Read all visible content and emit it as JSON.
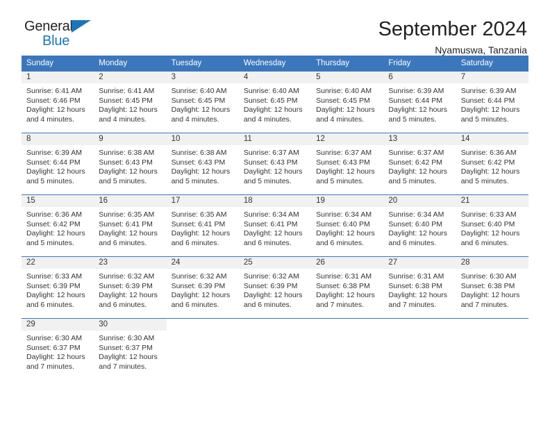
{
  "brand": {
    "name_part1": "General",
    "name_part2": "Blue",
    "accent_color": "#1b75bb"
  },
  "header": {
    "title": "September 2024",
    "location": "Nyamuswa, Tanzania"
  },
  "calendar": {
    "header_bg": "#3b77bc",
    "daynum_bg": "#f1f1f1",
    "weekday_headers": [
      "Sunday",
      "Monday",
      "Tuesday",
      "Wednesday",
      "Thursday",
      "Friday",
      "Saturday"
    ],
    "weeks": [
      [
        {
          "day": "1",
          "sunrise": "Sunrise: 6:41 AM",
          "sunset": "Sunset: 6:46 PM",
          "daylight": "Daylight: 12 hours and 4 minutes."
        },
        {
          "day": "2",
          "sunrise": "Sunrise: 6:41 AM",
          "sunset": "Sunset: 6:45 PM",
          "daylight": "Daylight: 12 hours and 4 minutes."
        },
        {
          "day": "3",
          "sunrise": "Sunrise: 6:40 AM",
          "sunset": "Sunset: 6:45 PM",
          "daylight": "Daylight: 12 hours and 4 minutes."
        },
        {
          "day": "4",
          "sunrise": "Sunrise: 6:40 AM",
          "sunset": "Sunset: 6:45 PM",
          "daylight": "Daylight: 12 hours and 4 minutes."
        },
        {
          "day": "5",
          "sunrise": "Sunrise: 6:40 AM",
          "sunset": "Sunset: 6:45 PM",
          "daylight": "Daylight: 12 hours and 4 minutes."
        },
        {
          "day": "6",
          "sunrise": "Sunrise: 6:39 AM",
          "sunset": "Sunset: 6:44 PM",
          "daylight": "Daylight: 12 hours and 5 minutes."
        },
        {
          "day": "7",
          "sunrise": "Sunrise: 6:39 AM",
          "sunset": "Sunset: 6:44 PM",
          "daylight": "Daylight: 12 hours and 5 minutes."
        }
      ],
      [
        {
          "day": "8",
          "sunrise": "Sunrise: 6:39 AM",
          "sunset": "Sunset: 6:44 PM",
          "daylight": "Daylight: 12 hours and 5 minutes."
        },
        {
          "day": "9",
          "sunrise": "Sunrise: 6:38 AM",
          "sunset": "Sunset: 6:43 PM",
          "daylight": "Daylight: 12 hours and 5 minutes."
        },
        {
          "day": "10",
          "sunrise": "Sunrise: 6:38 AM",
          "sunset": "Sunset: 6:43 PM",
          "daylight": "Daylight: 12 hours and 5 minutes."
        },
        {
          "day": "11",
          "sunrise": "Sunrise: 6:37 AM",
          "sunset": "Sunset: 6:43 PM",
          "daylight": "Daylight: 12 hours and 5 minutes."
        },
        {
          "day": "12",
          "sunrise": "Sunrise: 6:37 AM",
          "sunset": "Sunset: 6:43 PM",
          "daylight": "Daylight: 12 hours and 5 minutes."
        },
        {
          "day": "13",
          "sunrise": "Sunrise: 6:37 AM",
          "sunset": "Sunset: 6:42 PM",
          "daylight": "Daylight: 12 hours and 5 minutes."
        },
        {
          "day": "14",
          "sunrise": "Sunrise: 6:36 AM",
          "sunset": "Sunset: 6:42 PM",
          "daylight": "Daylight: 12 hours and 5 minutes."
        }
      ],
      [
        {
          "day": "15",
          "sunrise": "Sunrise: 6:36 AM",
          "sunset": "Sunset: 6:42 PM",
          "daylight": "Daylight: 12 hours and 5 minutes."
        },
        {
          "day": "16",
          "sunrise": "Sunrise: 6:35 AM",
          "sunset": "Sunset: 6:41 PM",
          "daylight": "Daylight: 12 hours and 6 minutes."
        },
        {
          "day": "17",
          "sunrise": "Sunrise: 6:35 AM",
          "sunset": "Sunset: 6:41 PM",
          "daylight": "Daylight: 12 hours and 6 minutes."
        },
        {
          "day": "18",
          "sunrise": "Sunrise: 6:34 AM",
          "sunset": "Sunset: 6:41 PM",
          "daylight": "Daylight: 12 hours and 6 minutes."
        },
        {
          "day": "19",
          "sunrise": "Sunrise: 6:34 AM",
          "sunset": "Sunset: 6:40 PM",
          "daylight": "Daylight: 12 hours and 6 minutes."
        },
        {
          "day": "20",
          "sunrise": "Sunrise: 6:34 AM",
          "sunset": "Sunset: 6:40 PM",
          "daylight": "Daylight: 12 hours and 6 minutes."
        },
        {
          "day": "21",
          "sunrise": "Sunrise: 6:33 AM",
          "sunset": "Sunset: 6:40 PM",
          "daylight": "Daylight: 12 hours and 6 minutes."
        }
      ],
      [
        {
          "day": "22",
          "sunrise": "Sunrise: 6:33 AM",
          "sunset": "Sunset: 6:39 PM",
          "daylight": "Daylight: 12 hours and 6 minutes."
        },
        {
          "day": "23",
          "sunrise": "Sunrise: 6:32 AM",
          "sunset": "Sunset: 6:39 PM",
          "daylight": "Daylight: 12 hours and 6 minutes."
        },
        {
          "day": "24",
          "sunrise": "Sunrise: 6:32 AM",
          "sunset": "Sunset: 6:39 PM",
          "daylight": "Daylight: 12 hours and 6 minutes."
        },
        {
          "day": "25",
          "sunrise": "Sunrise: 6:32 AM",
          "sunset": "Sunset: 6:39 PM",
          "daylight": "Daylight: 12 hours and 6 minutes."
        },
        {
          "day": "26",
          "sunrise": "Sunrise: 6:31 AM",
          "sunset": "Sunset: 6:38 PM",
          "daylight": "Daylight: 12 hours and 7 minutes."
        },
        {
          "day": "27",
          "sunrise": "Sunrise: 6:31 AM",
          "sunset": "Sunset: 6:38 PM",
          "daylight": "Daylight: 12 hours and 7 minutes."
        },
        {
          "day": "28",
          "sunrise": "Sunrise: 6:30 AM",
          "sunset": "Sunset: 6:38 PM",
          "daylight": "Daylight: 12 hours and 7 minutes."
        }
      ],
      [
        {
          "day": "29",
          "sunrise": "Sunrise: 6:30 AM",
          "sunset": "Sunset: 6:37 PM",
          "daylight": "Daylight: 12 hours and 7 minutes."
        },
        {
          "day": "30",
          "sunrise": "Sunrise: 6:30 AM",
          "sunset": "Sunset: 6:37 PM",
          "daylight": "Daylight: 12 hours and 7 minutes."
        },
        {
          "day": "",
          "sunrise": "",
          "sunset": "",
          "daylight": ""
        },
        {
          "day": "",
          "sunrise": "",
          "sunset": "",
          "daylight": ""
        },
        {
          "day": "",
          "sunrise": "",
          "sunset": "",
          "daylight": ""
        },
        {
          "day": "",
          "sunrise": "",
          "sunset": "",
          "daylight": ""
        },
        {
          "day": "",
          "sunrise": "",
          "sunset": "",
          "daylight": ""
        }
      ]
    ]
  }
}
